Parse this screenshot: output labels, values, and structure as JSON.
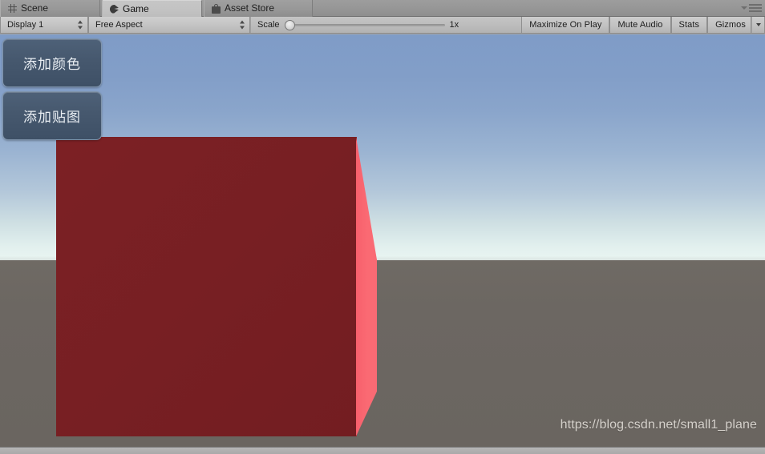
{
  "window": {
    "tabs": [
      {
        "label": "Scene",
        "icon": "grid-icon",
        "active": false
      },
      {
        "label": "Game",
        "icon": "game-controller-icon",
        "active": true
      },
      {
        "label": "Asset Store",
        "icon": "shopping-bag-icon",
        "active": false
      }
    ],
    "panel_menu_icon": "panel-options-icon"
  },
  "toolbar": {
    "display_dropdown": "Display 1",
    "aspect_dropdown": "Free Aspect",
    "scale_label": "Scale",
    "scale_value": "1x",
    "scale_slider_percent": 0,
    "maximize_on_play": "Maximize On Play",
    "mute_audio": "Mute Audio",
    "stats": "Stats",
    "gizmos": "Gizmos",
    "gizmos_caret_icon": "chevron-down-icon"
  },
  "game_ui": {
    "buttons": [
      {
        "label": "添加颜色",
        "name": "add-color-button"
      },
      {
        "label": "添加贴图",
        "name": "add-texture-button"
      }
    ]
  },
  "scene": {
    "watermark": "https://blog.csdn.net/small1_plane",
    "sky_top_color": "#7f9cc7",
    "sky_horizon_color": "#e9f5f2",
    "ground_color": "#6b6661",
    "cube_front_color": "#7c2024",
    "cube_side_color": "#f7606c"
  }
}
